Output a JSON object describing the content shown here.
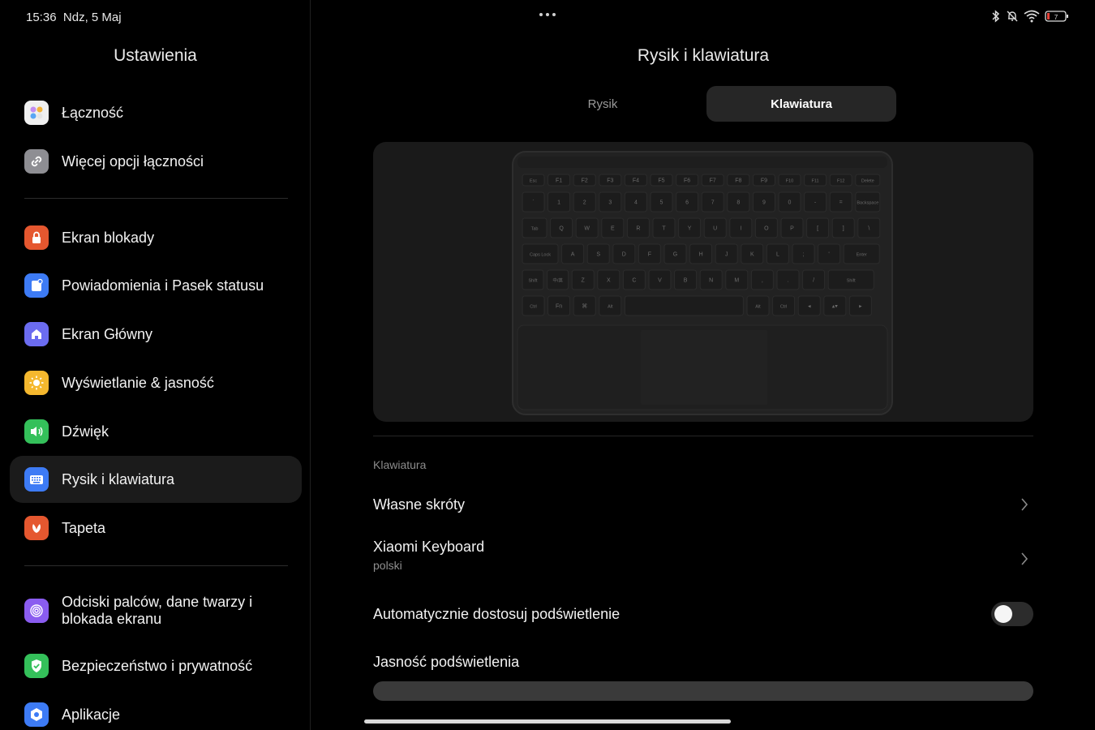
{
  "status": {
    "time": "15:36",
    "date": "Ndz, 5 Maj",
    "battery": "7"
  },
  "left": {
    "title": "Ustawienia",
    "items": [
      {
        "label": "Łączność",
        "icon": "connectivity-icon",
        "color": "#f0f0f0"
      },
      {
        "label": "Więcej opcji łączności",
        "icon": "link-icon",
        "color": "#8e8e93"
      },
      {
        "label": "Ekran blokady",
        "icon": "lock-icon",
        "color": "#e5572f"
      },
      {
        "label": "Powiadomienia i Pasek statusu",
        "icon": "notification-icon",
        "color": "#3d7bf5"
      },
      {
        "label": "Ekran Główny",
        "icon": "home-icon",
        "color": "#6b6cf0"
      },
      {
        "label": "Wyświetlanie & jasność",
        "icon": "sun-icon",
        "color": "#f5b82e"
      },
      {
        "label": "Dźwięk",
        "icon": "speaker-icon",
        "color": "#34c05a"
      },
      {
        "label": "Rysik i klawiatura",
        "icon": "keyboard-icon",
        "color": "#3d7bf5"
      },
      {
        "label": "Tapeta",
        "icon": "wallpaper-icon",
        "color": "#e5572f"
      },
      {
        "label": "Odciski palców, dane twarzy i blokada ekranu",
        "icon": "fingerprint-icon",
        "color": "#8a5cf0"
      },
      {
        "label": "Bezpieczeństwo i prywatność",
        "icon": "shield-icon",
        "color": "#34c05a"
      },
      {
        "label": "Aplikacje",
        "icon": "apps-icon",
        "color": "#3d7bf5"
      }
    ]
  },
  "right": {
    "title": "Rysik i klawiatura",
    "tabs": [
      "Rysik",
      "Klawiatura"
    ],
    "selected_tab": "Klawiatura",
    "section_label": "Klawiatura",
    "rows": {
      "custom_shortcuts": "Własne skróty",
      "keyboard_name": "Xiaomi Keyboard",
      "keyboard_lang": "polski",
      "auto_backlight": "Automatycznie dostosuj podświetlenie",
      "auto_backlight_on": false,
      "backlight_brightness": "Jasność podświetlenia"
    },
    "keyboard_keys": {
      "row0": [
        "Esc",
        "F1",
        "F2",
        "F3",
        "F4",
        "F5",
        "F6",
        "F7",
        "F8",
        "F9",
        "F10",
        "F11",
        "F12",
        "Delete"
      ],
      "row1": [
        "`",
        "1",
        "2",
        "3",
        "4",
        "5",
        "6",
        "7",
        "8",
        "9",
        "0",
        "-",
        "=",
        "Backspace"
      ],
      "row2": [
        "Tab",
        "Q",
        "W",
        "E",
        "R",
        "T",
        "Y",
        "U",
        "I",
        "O",
        "P",
        "[",
        "]",
        "\\"
      ],
      "row3": [
        "Caps Lock",
        "A",
        "S",
        "D",
        "F",
        "G",
        "H",
        "J",
        "K",
        "L",
        ";",
        "'",
        "Enter"
      ],
      "row4": [
        "Shift",
        "中/英",
        "Z",
        "X",
        "C",
        "V",
        "B",
        "N",
        "M",
        ",",
        ".",
        "/",
        "Shift"
      ],
      "row5": [
        "Ctrl",
        "Fn",
        "⌘",
        "Alt",
        "",
        "Alt",
        "Ctrl",
        "◂",
        "▴▾",
        "▸"
      ]
    }
  }
}
